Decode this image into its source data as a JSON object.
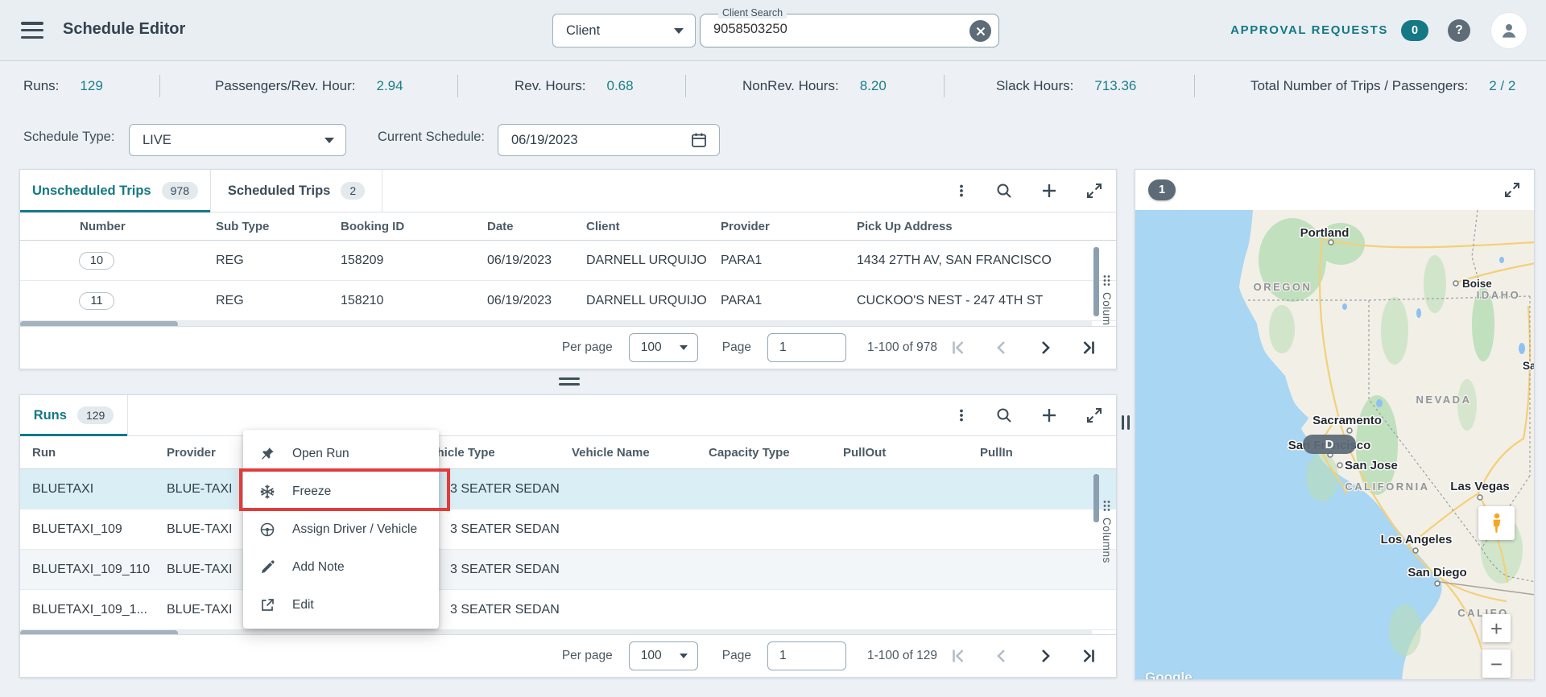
{
  "header": {
    "title": "Schedule Editor",
    "client_type_value": "Client",
    "client_search_label": "Client Search",
    "client_search_value": "9058503250",
    "approval_label": "APPROVAL REQUESTS",
    "approval_count": "0",
    "help_glyph": "?"
  },
  "stats": [
    {
      "label": "Runs:",
      "value": "129"
    },
    {
      "label": "Passengers/Rev. Hour:",
      "value": "2.94"
    },
    {
      "label": "Rev. Hours:",
      "value": "0.68"
    },
    {
      "label": "NonRev. Hours:",
      "value": "8.20"
    },
    {
      "label": "Slack Hours:",
      "value": "713.36"
    },
    {
      "label": "Total Number of Trips / Passengers:",
      "value": "2 / 2"
    }
  ],
  "filters": {
    "schedule_type_label": "Schedule Type:",
    "schedule_type_value": "LIVE",
    "current_schedule_label": "Current Schedule:",
    "current_schedule_value": "06/19/2023"
  },
  "trips_panel": {
    "tabs": [
      {
        "label": "Unscheduled Trips",
        "badge": "978"
      },
      {
        "label": "Scheduled Trips",
        "badge": "2"
      }
    ],
    "columns": [
      "Number",
      "Sub Type",
      "Booking ID",
      "Date",
      "Client",
      "Provider",
      "Pick Up Address"
    ],
    "rows": [
      [
        "10",
        "REG",
        "158209",
        "06/19/2023",
        "DARNELL URQUIJO",
        "PARA1",
        "1434 27TH AV, SAN FRANCISCO"
      ],
      [
        "11",
        "REG",
        "158210",
        "06/19/2023",
        "DARNELL URQUIJO",
        "PARA1",
        "CUCKOO'S NEST - 247 4TH ST"
      ]
    ],
    "columns_toggle": "Columns",
    "pagination": {
      "per_page_label": "Per page",
      "per_page_value": "100",
      "page_label": "Page",
      "page_value": "1",
      "range": "1-100 of 978"
    }
  },
  "runs_panel": {
    "tab": {
      "label": "Runs",
      "badge": "129"
    },
    "columns": [
      "Run",
      "Provider",
      "Vehicle Type",
      "Vehicle Name",
      "Capacity Type",
      "PullOut",
      "PullIn"
    ],
    "rows": [
      [
        "BLUETAXI",
        "BLUE-TAXI",
        "3 SEATER SEDAN",
        "",
        "",
        "",
        ""
      ],
      [
        "BLUETAXI_109",
        "BLUE-TAXI",
        "3 SEATER SEDAN",
        "",
        "",
        "",
        ""
      ],
      [
        "BLUETAXI_109_110",
        "BLUE-TAXI",
        "3 SEATER SEDAN",
        "",
        "",
        "",
        ""
      ],
      [
        "BLUETAXI_109_1...",
        "BLUE-TAXI",
        "3 SEATER SEDAN",
        "",
        "",
        "",
        ""
      ]
    ],
    "columns_toggle": "Columns",
    "pagination": {
      "per_page_label": "Per page",
      "per_page_value": "100",
      "page_label": "Page",
      "page_value": "1",
      "range": "1-100 of 129"
    }
  },
  "context_menu": {
    "items": [
      {
        "label": "Open Run"
      },
      {
        "label": "Freeze"
      },
      {
        "label": "Assign Driver / Vehicle"
      },
      {
        "label": "Add Note"
      },
      {
        "label": "Edit"
      }
    ]
  },
  "map": {
    "marker_badge": "1",
    "d_marker": "D",
    "labels": {
      "portland": "Portland",
      "oregon": "OREGON",
      "boise": "Boise",
      "idaho": "IDAHO",
      "sa_cut": "Sa",
      "sacramento": "Sacramento",
      "san_francisco": "San Francisco",
      "san_jose": "San Jose",
      "nevada": "NEVADA",
      "california": "CALIFORNIA",
      "las_vegas": "Las Vegas",
      "los_angeles": "Los Angeles",
      "san_diego": "San Diego",
      "baja": "CALIFO",
      "google": "Google"
    }
  },
  "colors": {
    "accent_teal": "#147885",
    "annotation_red": "#e23b3b",
    "selected_row": "#d9eef5",
    "header_bg": "#e9eef3"
  }
}
